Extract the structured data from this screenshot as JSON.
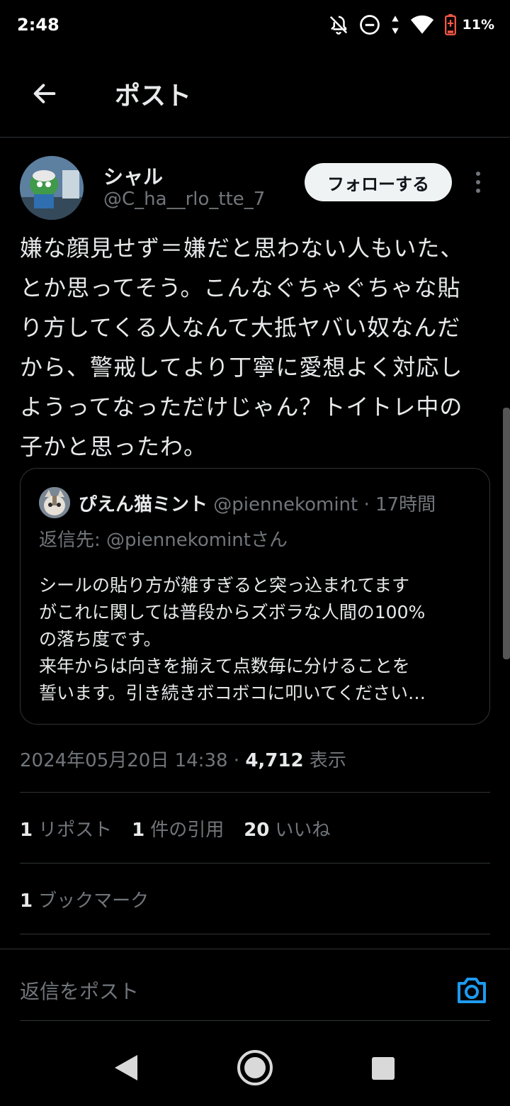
{
  "status_bar": {
    "time": "2:48",
    "battery": "11%"
  },
  "header": {
    "title": "ポスト"
  },
  "author": {
    "name": "シャル",
    "handle": "@C_ha__rlo_tte_7",
    "follow_label": "フォローする"
  },
  "post": {
    "text": "嫌な顔見せず＝嫌だと思わない人もいた、\nとか思ってそう。こんなぐちゃぐちゃな貼\nり方してくる人なんて大抵ヤバい奴なんだ\nから、警戒してより丁寧に愛想よく対応し\nようってなっただけじゃん？トイトレ中の\n子かと思ったわ。"
  },
  "quote": {
    "name": "ぴえん猫ミント",
    "handle": "@piennekomint",
    "time": "· 17時間",
    "reply_to": "返信先: @piennekomintさん",
    "text": "シールの貼り方が雑すぎると突っ込まれてます\nがこれに関しては普段からズボラな人間の100%\nの落ち度です。\n来年からは向きを揃えて点数毎に分けることを\n誓います。引き続きボコボコに叩いてください…"
  },
  "meta": {
    "datetime": "2024年05月20日 14:38 · ",
    "views": "4,712",
    "views_label": " 表示"
  },
  "stats": {
    "reposts_count": "1",
    "reposts_label": "リポスト",
    "quotes_count": "1",
    "quotes_label": "件の引用",
    "likes_count": "20",
    "likes_label": "いいね"
  },
  "bookmarks": {
    "count": "1",
    "label": "ブックマーク"
  },
  "reply": {
    "placeholder": "返信をポスト"
  },
  "colors": {
    "accent": "#1d9bf0",
    "background": "#000000",
    "muted": "#71767b",
    "border": "#2f3336"
  },
  "icons": {
    "back": "arrow-left-icon",
    "more": "more-vertical-icon",
    "camera": "camera-icon"
  }
}
